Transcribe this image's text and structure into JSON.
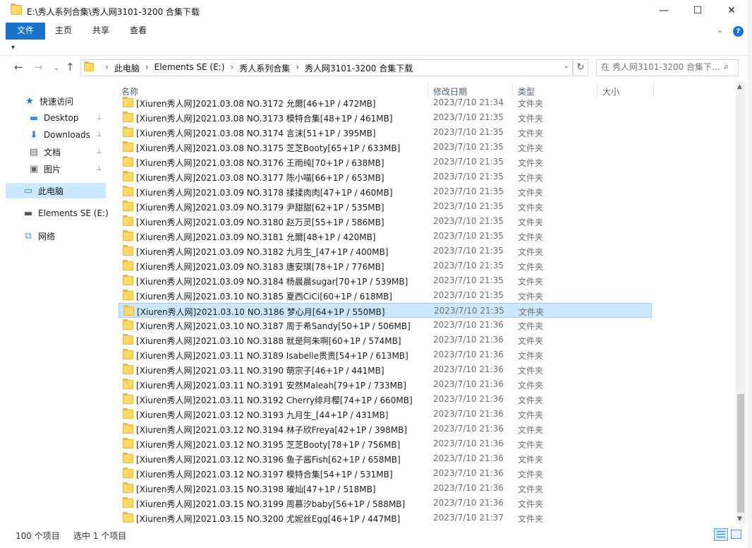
{
  "window": {
    "title": "E:\\秀人系列合集\\秀人网3101-3200 合集下载",
    "minimize_glyph": "—",
    "maximize_glyph": "☐",
    "close_glyph": "✕"
  },
  "ribbon": {
    "tabs": [
      {
        "label": "文件"
      },
      {
        "label": "主页"
      },
      {
        "label": "共享"
      },
      {
        "label": "查看"
      }
    ],
    "help_glyph": "?",
    "accent": "#1a73c8"
  },
  "address": {
    "crumbs": [
      "此电脑",
      "Elements SE (E:)",
      "秀人系列合集",
      "秀人网3101-3200 合集下载"
    ],
    "search_placeholder": "在 秀人网3101-3200 合集下..."
  },
  "nav": {
    "quick_access": "快速访问",
    "items": [
      {
        "label": "Desktop",
        "icon": "desktop-icon"
      },
      {
        "label": "Downloads",
        "icon": "download-icon"
      },
      {
        "label": "文档",
        "icon": "documents-icon"
      },
      {
        "label": "图片",
        "icon": "pictures-icon"
      }
    ],
    "this_pc": "此电脑",
    "drive": "Elements SE (E:)",
    "network": "网络"
  },
  "columns": {
    "name": "名称",
    "date": "修改日期",
    "type": "类型",
    "size": "大小"
  },
  "files": [
    {
      "name": "[Xiuren秀人网]2021.03.08 NO.3172 允爾[46+1P / 472MB]",
      "date": "2023/7/10 21:34",
      "type": "文件夹"
    },
    {
      "name": "[Xiuren秀人网]2021.03.08 NO.3173 模特合集[48+1P / 461MB]",
      "date": "2023/7/10 21:35",
      "type": "文件夹"
    },
    {
      "name": "[Xiuren秀人网]2021.03.08 NO.3174 言沫[51+1P / 395MB]",
      "date": "2023/7/10 21:35",
      "type": "文件夹"
    },
    {
      "name": "[Xiuren秀人网]2021.03.08 NO.3175 芝芝Booty[65+1P / 633MB]",
      "date": "2023/7/10 21:35",
      "type": "文件夹"
    },
    {
      "name": "[Xiuren秀人网]2021.03.08 NO.3176 王雨纯[70+1P / 638MB]",
      "date": "2023/7/10 21:35",
      "type": "文件夹"
    },
    {
      "name": "[Xiuren秀人网]2021.03.08 NO.3177 陈小喵[66+1P / 653MB]",
      "date": "2023/7/10 21:35",
      "type": "文件夹"
    },
    {
      "name": "[Xiuren秀人网]2021.03.09 NO.3178 揉揉肉肉[47+1P / 460MB]",
      "date": "2023/7/10 21:35",
      "type": "文件夹"
    },
    {
      "name": "[Xiuren秀人网]2021.03.09 NO.3179 尹甜甜[62+1P / 535MB]",
      "date": "2023/7/10 21:35",
      "type": "文件夹"
    },
    {
      "name": "[Xiuren秀人网]2021.03.09 NO.3180 赵万灵[55+1P / 586MB]",
      "date": "2023/7/10 21:35",
      "type": "文件夹"
    },
    {
      "name": "[Xiuren秀人网]2021.03.09 NO.3181 允爾[48+1P / 420MB]",
      "date": "2023/7/10 21:35",
      "type": "文件夹"
    },
    {
      "name": "[Xiuren秀人网]2021.03.09 NO.3182 九月生_[47+1P / 400MB]",
      "date": "2023/7/10 21:35",
      "type": "文件夹"
    },
    {
      "name": "[Xiuren秀人网]2021.03.09 NO.3183 唐安琪[78+1P / 776MB]",
      "date": "2023/7/10 21:35",
      "type": "文件夹"
    },
    {
      "name": "[Xiuren秀人网]2021.03.09 NO.3184 杨晨晨sugar[70+1P / 539MB]",
      "date": "2023/7/10 21:35",
      "type": "文件夹"
    },
    {
      "name": "[Xiuren秀人网]2021.03.10 NO.3185 夏西CiCi[60+1P / 618MB]",
      "date": "2023/7/10 21:35",
      "type": "文件夹"
    },
    {
      "name": "[Xiuren秀人网]2021.03.10 NO.3186 梦心月[64+1P / 550MB]",
      "date": "2023/7/10 21:35",
      "type": "文件夹",
      "selected": true
    },
    {
      "name": "[Xiuren秀人网]2021.03.10 NO.3187 周于希Sandy[50+1P / 506MB]",
      "date": "2023/7/10 21:36",
      "type": "文件夹"
    },
    {
      "name": "[Xiuren秀人网]2021.03.10 NO.3188 就是阿朱啊[60+1P / 574MB]",
      "date": "2023/7/10 21:36",
      "type": "文件夹"
    },
    {
      "name": "[Xiuren秀人网]2021.03.11 NO.3189 Isabelle贵贵[54+1P / 613MB]",
      "date": "2023/7/10 21:36",
      "type": "文件夹"
    },
    {
      "name": "[Xiuren秀人网]2021.03.11 NO.3190 萌宗子[46+1P / 441MB]",
      "date": "2023/7/10 21:36",
      "type": "文件夹"
    },
    {
      "name": "[Xiuren秀人网]2021.03.11 NO.3191 安然Maleah[79+1P / 733MB]",
      "date": "2023/7/10 21:36",
      "type": "文件夹"
    },
    {
      "name": "[Xiuren秀人网]2021.03.11 NO.3192 Cherry绯月樱[74+1P / 660MB]",
      "date": "2023/7/10 21:36",
      "type": "文件夹"
    },
    {
      "name": "[Xiuren秀人网]2021.03.12 NO.3193 九月生_[44+1P / 431MB]",
      "date": "2023/7/10 21:36",
      "type": "文件夹"
    },
    {
      "name": "[Xiuren秀人网]2021.03.12 NO.3194 林子欣Freya[42+1P / 398MB]",
      "date": "2023/7/10 21:36",
      "type": "文件夹"
    },
    {
      "name": "[Xiuren秀人网]2021.03.12 NO.3195 芝芝Booty[78+1P / 756MB]",
      "date": "2023/7/10 21:36",
      "type": "文件夹"
    },
    {
      "name": "[Xiuren秀人网]2021.03.12 NO.3196 鱼子酱Fish[62+1P / 658MB]",
      "date": "2023/7/10 21:36",
      "type": "文件夹"
    },
    {
      "name": "[Xiuren秀人网]2021.03.12 NO.3197 模特合集[54+1P / 531MB]",
      "date": "2023/7/10 21:36",
      "type": "文件夹"
    },
    {
      "name": "[Xiuren秀人网]2021.03.15 NO.3198 璀灿[47+1P / 518MB]",
      "date": "2023/7/10 21:36",
      "type": "文件夹"
    },
    {
      "name": "[Xiuren秀人网]2021.03.15 NO.3199 周慕汐baby[56+1P / 588MB]",
      "date": "2023/7/10 21:36",
      "type": "文件夹"
    },
    {
      "name": "[Xiuren秀人网]2021.03.15 NO.3200 尤妮丝Egg[46+1P / 447MB]",
      "date": "2023/7/10 21:37",
      "type": "文件夹"
    }
  ],
  "status": {
    "count": "100 个项目",
    "selected": "选中 1 个项目"
  },
  "colors": {
    "selection": "#cce8ff",
    "folder": "#ffd966"
  }
}
